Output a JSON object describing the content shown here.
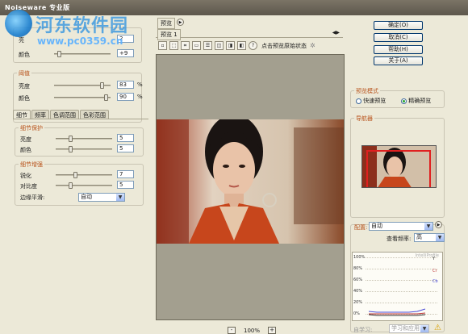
{
  "window": {
    "title": "Noiseware 专业版"
  },
  "watermark": {
    "title": "河东软件园",
    "url": "www.pc0359.cn"
  },
  "left": {
    "top_group": {
      "partial_label": "亮",
      "brightness_value": "2",
      "color_label": "颜色",
      "color_value": "+9"
    },
    "threshold": {
      "legend": "阈值",
      "brightness_label": "亮度",
      "brightness_value": "83",
      "brightness_unit": "%",
      "color_label": "颜色",
      "color_value": "90",
      "color_unit": "%"
    },
    "tabs": [
      "细节",
      "频率",
      "色调范围",
      "色彩范围"
    ],
    "detail_protect": {
      "legend": "细节保护",
      "brightness_label": "亮度",
      "brightness_value": "5",
      "color_label": "颜色",
      "color_value": "5"
    },
    "detail_enhance": {
      "legend": "细节增强",
      "sharpen_label": "锐化",
      "sharpen_value": "7",
      "contrast_label": "对比度",
      "contrast_value": "5",
      "edge_label": "边缘平滑:",
      "edge_value": "自动"
    }
  },
  "preview": {
    "tab_label": "预览",
    "subtab_label": "预览 1",
    "click_hint": "点击预览原始状态",
    "question_icon": "?",
    "zoom_minus": "-",
    "zoom_value": "100%",
    "zoom_plus": "+"
  },
  "right": {
    "buttons": {
      "ok": "确定(O)",
      "cancel": "取消(C)",
      "help": "帮助(H)",
      "about": "关于(A)"
    },
    "preview_mode": {
      "legend": "预览模式",
      "fast": "快速预览",
      "accurate": "精确预览"
    },
    "navigator_legend": "导航器",
    "config": {
      "label": "配置:",
      "value": "自动",
      "freq_label": "查看频率:",
      "freq_value": "高",
      "graph_y_labels": [
        "100%",
        "80%",
        "60%",
        "40%",
        "20%",
        "0%"
      ],
      "graph_series": [
        "Y",
        "Cr",
        "Cb"
      ],
      "graph_corner": "IntelliProfile",
      "self_learn_label": "自学习:",
      "self_learn_value": "学习和应用"
    }
  },
  "colors": {
    "accent_legend": "#b8531c",
    "title_bar": "#6a6458",
    "graph_series_cr": "#c03838",
    "graph_series_cb": "#4a4ad8"
  }
}
